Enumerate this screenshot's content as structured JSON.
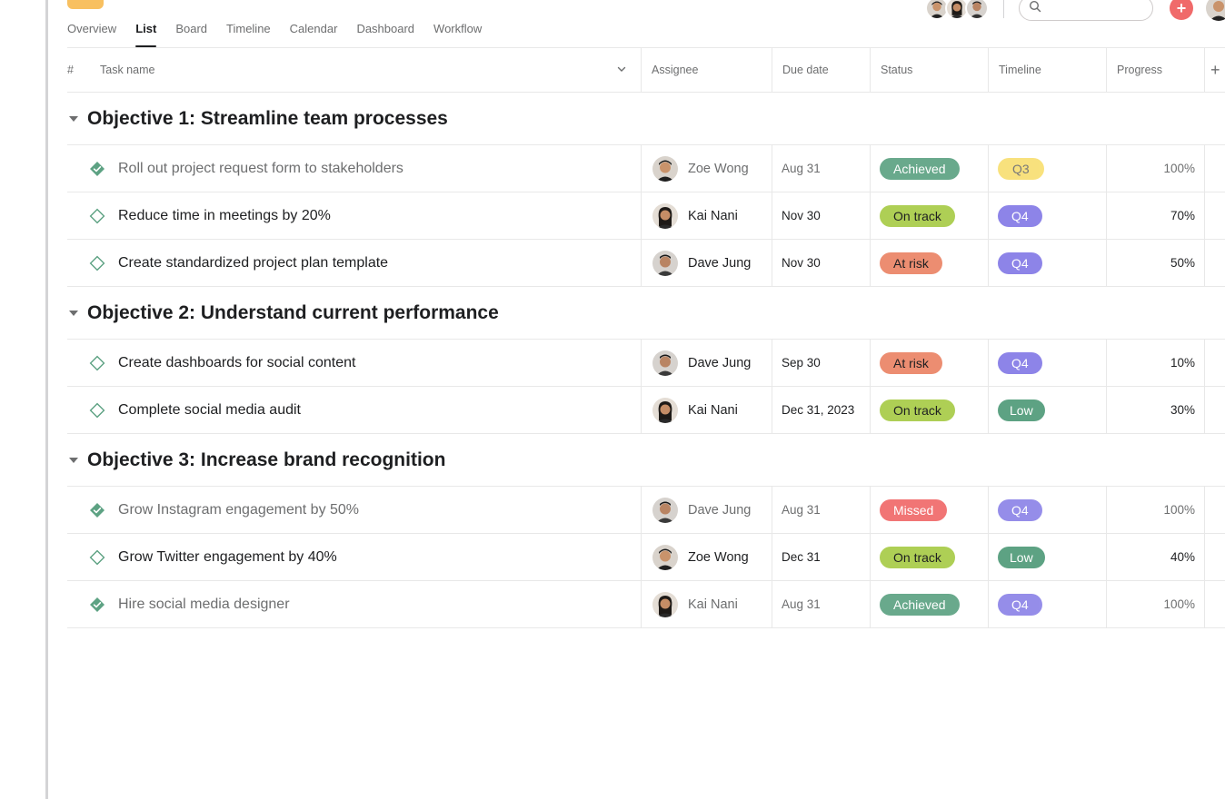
{
  "tabs": [
    {
      "label": "Overview",
      "active": false
    },
    {
      "label": "List",
      "active": true
    },
    {
      "label": "Board",
      "active": false
    },
    {
      "label": "Timeline",
      "active": false
    },
    {
      "label": "Calendar",
      "active": false
    },
    {
      "label": "Dashboard",
      "active": false
    },
    {
      "label": "Workflow",
      "active": false
    }
  ],
  "header": {
    "search_placeholder": "",
    "add_label": "+"
  },
  "columns": {
    "number": "#",
    "task_name": "Task name",
    "assignee": "Assignee",
    "due_date": "Due date",
    "status": "Status",
    "timeline": "Timeline",
    "progress": "Progress",
    "add": "+"
  },
  "sections": [
    {
      "title": "Objective 1: Streamline team processes",
      "tasks": [
        {
          "name": "Roll out project request form to stakeholders",
          "done": true,
          "assignee": "Zoe Wong",
          "due": "Aug 31",
          "status": "Achieved",
          "timeline": "Q3",
          "progress": "100%"
        },
        {
          "name": "Reduce time in meetings by 20%",
          "done": false,
          "assignee": "Kai Nani",
          "due": "Nov 30",
          "status": "On track",
          "timeline": "Q4",
          "progress": "70%"
        },
        {
          "name": "Create standardized project plan template",
          "done": false,
          "assignee": "Dave Jung",
          "due": "Nov 30",
          "status": "At risk",
          "timeline": "Q4",
          "progress": "50%"
        }
      ]
    },
    {
      "title": "Objective 2: Understand current performance",
      "tasks": [
        {
          "name": "Create dashboards for social content",
          "done": false,
          "assignee": "Dave Jung",
          "due": "Sep 30",
          "status": "At risk",
          "timeline": "Q4",
          "progress": "10%"
        },
        {
          "name": "Complete social media audit",
          "done": false,
          "assignee": "Kai Nani",
          "due": "Dec 31, 2023",
          "status": "On track",
          "timeline": "Low",
          "progress": "30%"
        }
      ]
    },
    {
      "title": "Objective 3: Increase brand recognition",
      "tasks": [
        {
          "name": "Grow Instagram engagement by 50%",
          "done": true,
          "assignee": "Dave Jung",
          "due": "Aug 31",
          "status": "Missed",
          "timeline": "Q4",
          "progress": "100%"
        },
        {
          "name": "Grow Twitter engagement by 40%",
          "done": false,
          "assignee": "Zoe Wong",
          "due": "Dec 31",
          "status": "On track",
          "timeline": "Low",
          "progress": "40%"
        },
        {
          "name": "Hire social media designer",
          "done": true,
          "assignee": "Kai Nani",
          "due": "Aug 31",
          "status": "Achieved",
          "timeline": "Q4",
          "progress": "100%"
        }
      ]
    }
  ],
  "colors": {
    "achieved": "#5da283",
    "on_track": "#aecf55",
    "at_risk": "#ec8d71",
    "missed": "#f06a6a",
    "q3": "#f8df72",
    "q4": "#8d84e8",
    "low": "#5da283",
    "add_button": "#f06a6a",
    "project_icon": "#f8c060"
  },
  "icons": {
    "done": "check-diamond-filled-icon",
    "open": "check-diamond-outline-icon",
    "search": "search-icon",
    "section": "caret-down-icon",
    "sort": "chevron-down-icon"
  }
}
